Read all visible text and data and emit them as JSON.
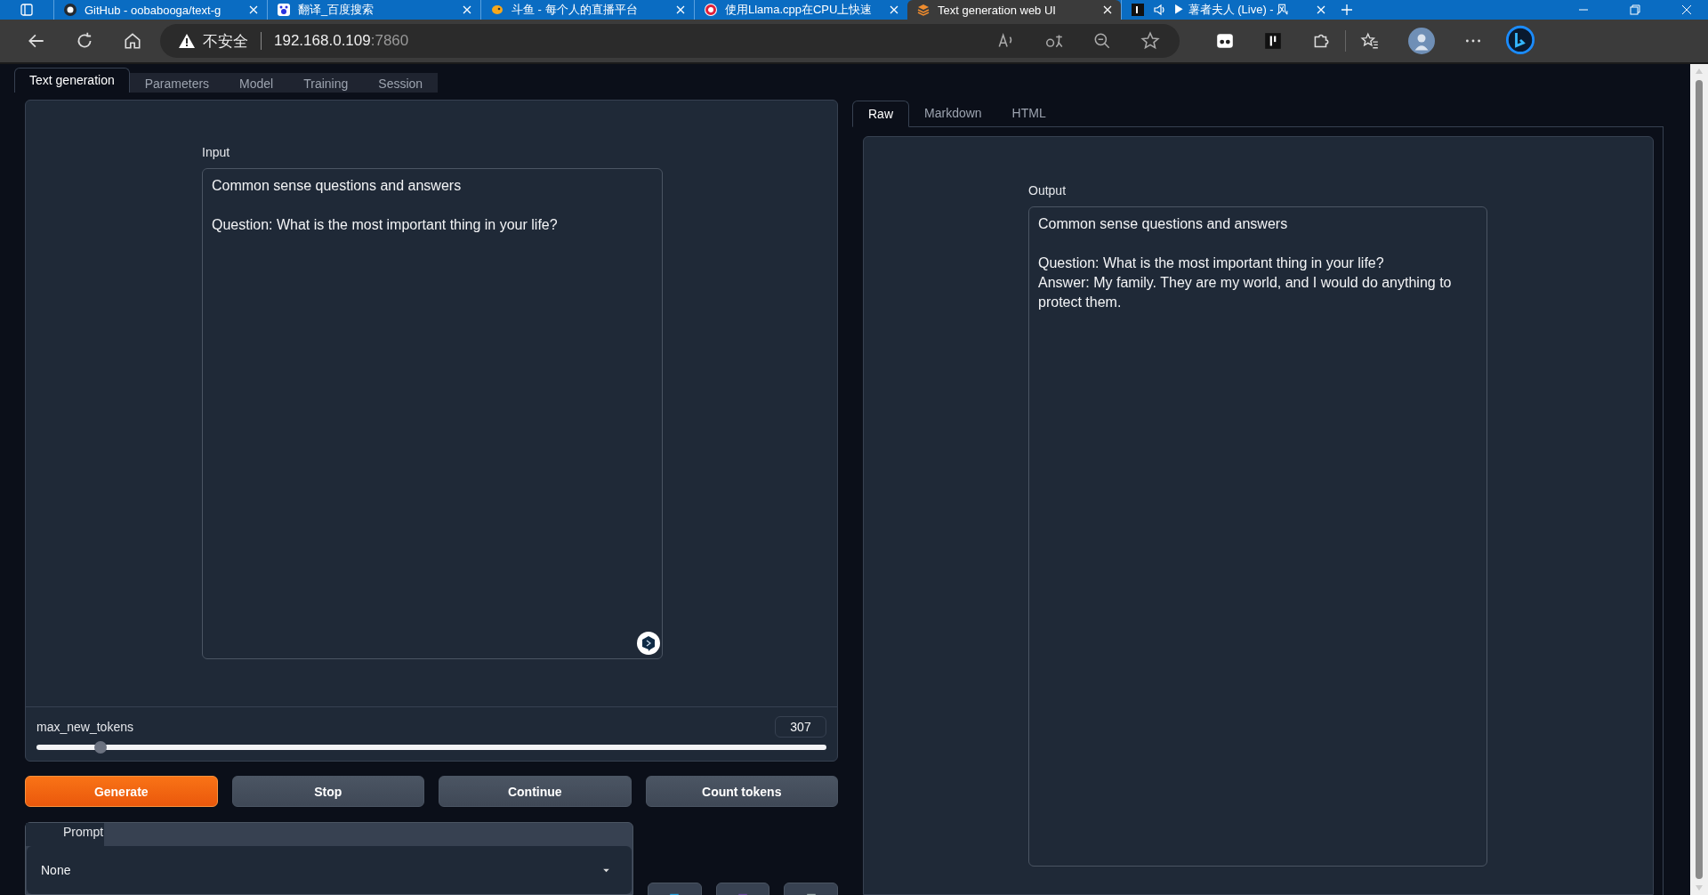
{
  "browser": {
    "tabs": [
      {
        "title": "GitHub - oobabooga/text-g",
        "selected": false
      },
      {
        "title": "翻译_百度搜索",
        "selected": false
      },
      {
        "title": "斗鱼 - 每个人的直播平台",
        "selected": false
      },
      {
        "title": "使用Llama.cpp在CPU上快速",
        "selected": false
      },
      {
        "title": "Text generation web UI",
        "selected": true
      },
      {
        "title": "▶ 薯者夫人 (Live) - 风",
        "selected": false
      }
    ],
    "address": {
      "security": "不安全",
      "host": "192.168.0.109",
      "port": ":7860"
    }
  },
  "app": {
    "tabs": [
      {
        "label": "Text generation",
        "selected": true
      },
      {
        "label": "Parameters",
        "selected": false
      },
      {
        "label": "Model",
        "selected": false
      },
      {
        "label": "Training",
        "selected": false
      },
      {
        "label": "Session",
        "selected": false
      }
    ],
    "input": {
      "label": "Input",
      "value": "Common sense questions and answers\n\nQuestion: What is the most important thing in your life?\n"
    },
    "max_new_tokens": {
      "label": "max_new_tokens",
      "value": "307",
      "level": 0.081
    },
    "buttons": [
      {
        "label": "Generate",
        "kind": "primary"
      },
      {
        "label": "Stop",
        "kind": "secondary"
      },
      {
        "label": "Continue",
        "kind": "secondary"
      },
      {
        "label": "Count tokens",
        "kind": "secondary"
      }
    ],
    "prompt": {
      "label": "Prompt",
      "value": "None"
    },
    "output_tabs": [
      {
        "label": "Raw",
        "selected": true
      },
      {
        "label": "Markdown",
        "selected": false
      },
      {
        "label": "HTML",
        "selected": false
      }
    ],
    "output": {
      "label": "Output",
      "value": "Common sense questions and answers\n\nQuestion: What is the most important thing in your life?\nAnswer: My family. They are my world, and I would do anything to protect them."
    }
  }
}
